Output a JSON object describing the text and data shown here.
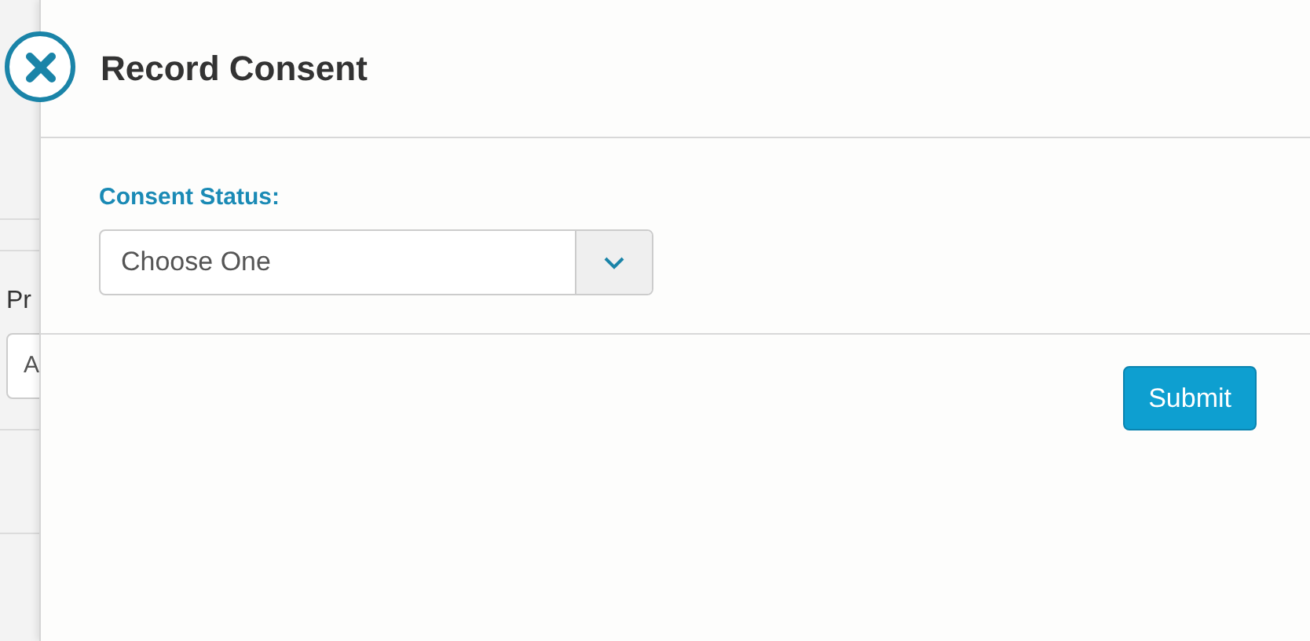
{
  "background_page": {
    "field_label": "Pr",
    "field_value": "A"
  },
  "dialog": {
    "title": "Record Consent",
    "fields": [
      {
        "label": "Consent Status:",
        "value": "Choose One"
      }
    ],
    "buttons": [
      "Submit"
    ]
  }
}
